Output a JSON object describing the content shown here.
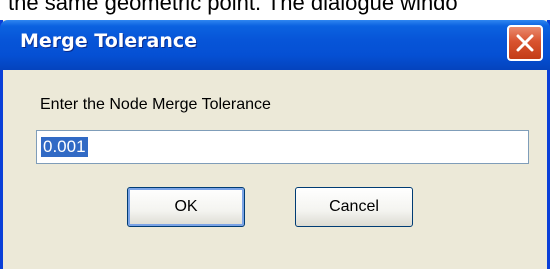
{
  "background_text": "the same geometric point. The dialogue windo",
  "dialog": {
    "title": "Merge Tolerance",
    "prompt": "Enter the Node Merge Tolerance",
    "tolerance_value": "0.001",
    "ok_label": "OK",
    "cancel_label": "Cancel"
  },
  "icons": {
    "close": "close-icon"
  },
  "colors": {
    "titlebar": "#0550d4",
    "dialog_bg": "#ece9d8",
    "close_button": "#d9532f",
    "selection": "#316ac5"
  }
}
